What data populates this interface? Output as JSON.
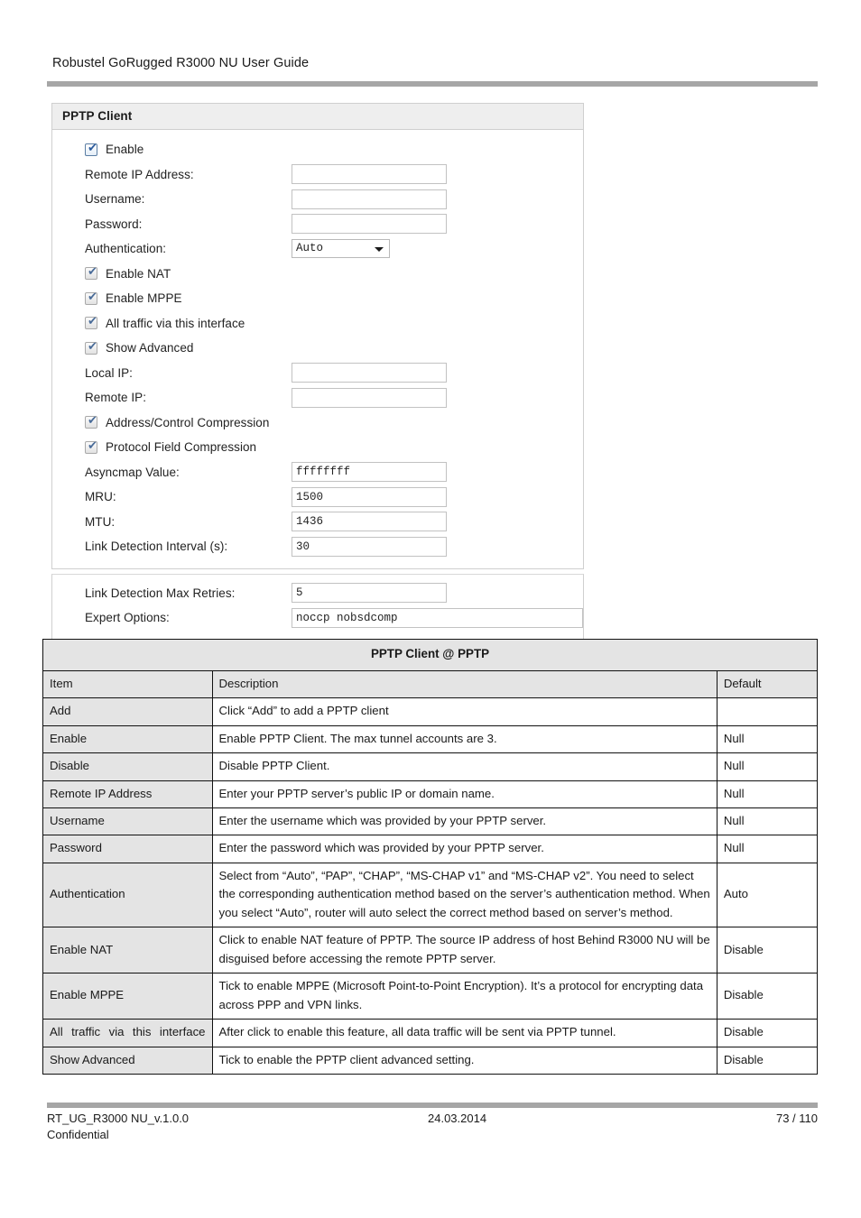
{
  "header": {
    "doc_title": "Robustel GoRugged R3000 NU User Guide"
  },
  "screenshot_panel": {
    "title": "PPTP Client",
    "fields": {
      "enable": {
        "label": "Enable",
        "checked": true
      },
      "remote_ip_address": {
        "label": "Remote IP Address:",
        "value": ""
      },
      "username": {
        "label": "Username:",
        "value": ""
      },
      "password": {
        "label": "Password:",
        "value": ""
      },
      "authentication": {
        "label": "Authentication:",
        "value": "Auto"
      },
      "enable_nat": {
        "label": "Enable NAT",
        "checked": true
      },
      "enable_mppe": {
        "label": "Enable MPPE",
        "checked": true
      },
      "all_traffic": {
        "label": "All traffic via this interface",
        "checked": true
      },
      "show_advanced": {
        "label": "Show Advanced",
        "checked": true
      },
      "local_ip": {
        "label": "Local IP:",
        "value": ""
      },
      "remote_ip": {
        "label": "Remote IP:",
        "value": ""
      },
      "address_control_compression": {
        "label": "Address/Control Compression",
        "checked": true
      },
      "protocol_field_compression": {
        "label": "Protocol Field Compression",
        "checked": true
      },
      "asyncmap_value": {
        "label": "Asyncmap Value:",
        "value": "ffffffff"
      },
      "mru": {
        "label": "MRU:",
        "value": "1500"
      },
      "mtu": {
        "label": "MTU:",
        "value": "1436"
      },
      "link_detection_interval": {
        "label": "Link Detection Interval (s):",
        "value": "30"
      },
      "link_detection_max_retries": {
        "label": "Link Detection Max Retries:",
        "value": "5"
      },
      "expert_options": {
        "label": "Expert Options:",
        "value": "noccp nobsdcomp"
      }
    }
  },
  "reference_table": {
    "title": "PPTP Client @ PPTP",
    "columns": [
      "Item",
      "Description",
      "Default"
    ],
    "rows": [
      {
        "item": "Add",
        "description": "Click “Add” to add a PPTP client",
        "default": ""
      },
      {
        "item": "Enable",
        "description": "Enable PPTP Client. The max tunnel accounts are 3.",
        "default": "Null"
      },
      {
        "item": "Disable",
        "description": "Disable PPTP Client.",
        "default": "Null"
      },
      {
        "item": "Remote IP Address",
        "description": "Enter your PPTP server’s public IP or domain name.",
        "default": "Null"
      },
      {
        "item": "Username",
        "description": "Enter the username which was provided by your PPTP server.",
        "default": "Null"
      },
      {
        "item": "Password",
        "description": "Enter the password which was provided by your PPTP server.",
        "default": "Null"
      },
      {
        "item": "Authentication",
        "description": "Select from “Auto”, “PAP”, “CHAP”, “MS-CHAP v1” and “MS-CHAP v2”. You need to select the corresponding authentication method based on the server’s authentication method. When you select “Auto”, router will auto select the correct method based on server’s method.",
        "default": "Auto"
      },
      {
        "item": "Enable NAT",
        "description": "Click to enable NAT feature of PPTP. The source IP address of host Behind R3000 NU will be disguised before accessing the remote PPTP server.",
        "default": "Disable"
      },
      {
        "item": "Enable MPPE",
        "description": "Tick to enable MPPE (Microsoft Point-to-Point Encryption). It’s a protocol for encrypting data across PPP and VPN links.",
        "default": "Disable"
      },
      {
        "item": "All traffic via this interface",
        "description": "After click to enable this feature, all data traffic will be sent via PPTP tunnel.",
        "default": "Disable"
      },
      {
        "item": "Show Advanced",
        "description": "Tick to enable the PPTP client advanced setting.",
        "default": "Disable"
      }
    ]
  },
  "footer": {
    "document_id": "RT_UG_R3000 NU_v.1.0.0",
    "date": "24.03.2014",
    "page": "73 / 110",
    "confidentiality": "Confidential"
  },
  "icons": {
    "checkbox_tick": "✔",
    "dropdown_arrow": "chevron-down-icon"
  },
  "colors": {
    "rule": "#a6a6a6",
    "panel_header": "#eeeeee",
    "table_shade": "#e4e4e4",
    "checkbox_blue": "#2c5c9e"
  }
}
